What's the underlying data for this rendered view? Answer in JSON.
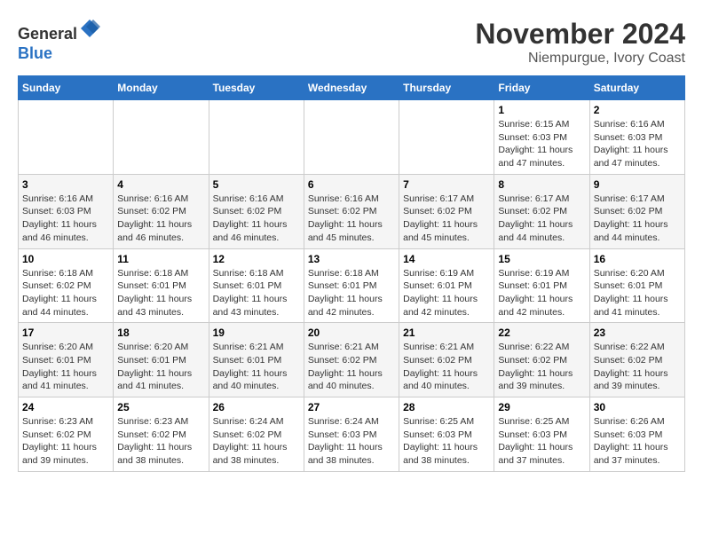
{
  "logo": {
    "line1": "General",
    "line2": "Blue"
  },
  "title": "November 2024",
  "location": "Niempurgue, Ivory Coast",
  "days_of_week": [
    "Sunday",
    "Monday",
    "Tuesday",
    "Wednesday",
    "Thursday",
    "Friday",
    "Saturday"
  ],
  "weeks": [
    [
      {
        "day": "",
        "info": ""
      },
      {
        "day": "",
        "info": ""
      },
      {
        "day": "",
        "info": ""
      },
      {
        "day": "",
        "info": ""
      },
      {
        "day": "",
        "info": ""
      },
      {
        "day": "1",
        "info": "Sunrise: 6:15 AM\nSunset: 6:03 PM\nDaylight: 11 hours and 47 minutes."
      },
      {
        "day": "2",
        "info": "Sunrise: 6:16 AM\nSunset: 6:03 PM\nDaylight: 11 hours and 47 minutes."
      }
    ],
    [
      {
        "day": "3",
        "info": "Sunrise: 6:16 AM\nSunset: 6:03 PM\nDaylight: 11 hours and 46 minutes."
      },
      {
        "day": "4",
        "info": "Sunrise: 6:16 AM\nSunset: 6:02 PM\nDaylight: 11 hours and 46 minutes."
      },
      {
        "day": "5",
        "info": "Sunrise: 6:16 AM\nSunset: 6:02 PM\nDaylight: 11 hours and 46 minutes."
      },
      {
        "day": "6",
        "info": "Sunrise: 6:16 AM\nSunset: 6:02 PM\nDaylight: 11 hours and 45 minutes."
      },
      {
        "day": "7",
        "info": "Sunrise: 6:17 AM\nSunset: 6:02 PM\nDaylight: 11 hours and 45 minutes."
      },
      {
        "day": "8",
        "info": "Sunrise: 6:17 AM\nSunset: 6:02 PM\nDaylight: 11 hours and 44 minutes."
      },
      {
        "day": "9",
        "info": "Sunrise: 6:17 AM\nSunset: 6:02 PM\nDaylight: 11 hours and 44 minutes."
      }
    ],
    [
      {
        "day": "10",
        "info": "Sunrise: 6:18 AM\nSunset: 6:02 PM\nDaylight: 11 hours and 44 minutes."
      },
      {
        "day": "11",
        "info": "Sunrise: 6:18 AM\nSunset: 6:01 PM\nDaylight: 11 hours and 43 minutes."
      },
      {
        "day": "12",
        "info": "Sunrise: 6:18 AM\nSunset: 6:01 PM\nDaylight: 11 hours and 43 minutes."
      },
      {
        "day": "13",
        "info": "Sunrise: 6:18 AM\nSunset: 6:01 PM\nDaylight: 11 hours and 42 minutes."
      },
      {
        "day": "14",
        "info": "Sunrise: 6:19 AM\nSunset: 6:01 PM\nDaylight: 11 hours and 42 minutes."
      },
      {
        "day": "15",
        "info": "Sunrise: 6:19 AM\nSunset: 6:01 PM\nDaylight: 11 hours and 42 minutes."
      },
      {
        "day": "16",
        "info": "Sunrise: 6:20 AM\nSunset: 6:01 PM\nDaylight: 11 hours and 41 minutes."
      }
    ],
    [
      {
        "day": "17",
        "info": "Sunrise: 6:20 AM\nSunset: 6:01 PM\nDaylight: 11 hours and 41 minutes."
      },
      {
        "day": "18",
        "info": "Sunrise: 6:20 AM\nSunset: 6:01 PM\nDaylight: 11 hours and 41 minutes."
      },
      {
        "day": "19",
        "info": "Sunrise: 6:21 AM\nSunset: 6:01 PM\nDaylight: 11 hours and 40 minutes."
      },
      {
        "day": "20",
        "info": "Sunrise: 6:21 AM\nSunset: 6:02 PM\nDaylight: 11 hours and 40 minutes."
      },
      {
        "day": "21",
        "info": "Sunrise: 6:21 AM\nSunset: 6:02 PM\nDaylight: 11 hours and 40 minutes."
      },
      {
        "day": "22",
        "info": "Sunrise: 6:22 AM\nSunset: 6:02 PM\nDaylight: 11 hours and 39 minutes."
      },
      {
        "day": "23",
        "info": "Sunrise: 6:22 AM\nSunset: 6:02 PM\nDaylight: 11 hours and 39 minutes."
      }
    ],
    [
      {
        "day": "24",
        "info": "Sunrise: 6:23 AM\nSunset: 6:02 PM\nDaylight: 11 hours and 39 minutes."
      },
      {
        "day": "25",
        "info": "Sunrise: 6:23 AM\nSunset: 6:02 PM\nDaylight: 11 hours and 38 minutes."
      },
      {
        "day": "26",
        "info": "Sunrise: 6:24 AM\nSunset: 6:02 PM\nDaylight: 11 hours and 38 minutes."
      },
      {
        "day": "27",
        "info": "Sunrise: 6:24 AM\nSunset: 6:03 PM\nDaylight: 11 hours and 38 minutes."
      },
      {
        "day": "28",
        "info": "Sunrise: 6:25 AM\nSunset: 6:03 PM\nDaylight: 11 hours and 38 minutes."
      },
      {
        "day": "29",
        "info": "Sunrise: 6:25 AM\nSunset: 6:03 PM\nDaylight: 11 hours and 37 minutes."
      },
      {
        "day": "30",
        "info": "Sunrise: 6:26 AM\nSunset: 6:03 PM\nDaylight: 11 hours and 37 minutes."
      }
    ]
  ]
}
